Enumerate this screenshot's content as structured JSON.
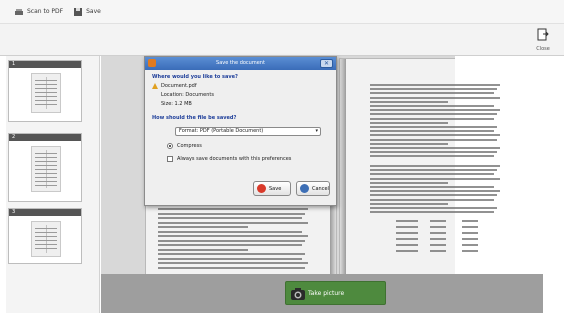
{
  "menubar": {
    "items": [
      {
        "label": "Scan to PDF",
        "icon": "scanner-icon"
      },
      {
        "label": "Save",
        "icon": "save-icon"
      }
    ]
  },
  "toolbar": {
    "close_label": "Close"
  },
  "sidebar": {
    "thumbnails": [
      {
        "num": "1"
      },
      {
        "num": "2"
      },
      {
        "num": "3"
      }
    ]
  },
  "dialog": {
    "title": "Save the document",
    "line1": "Where would you like to save?",
    "line2": "Document.pdf",
    "line3": "Location: Documents",
    "line4": "Size: 1.2 MB",
    "section": "How should the file be saved?",
    "select_value": "Format: PDF (Portable Document)",
    "radio_label": "Compress",
    "check_label": "Always save documents with this preferences",
    "save_label": "Save",
    "cancel_label": "Cancel"
  },
  "bottom": {
    "attach_label": "Take picture"
  },
  "colors": {
    "attach_green": "#4e8a3e",
    "titlebar_blue": "#3a6cb8"
  }
}
